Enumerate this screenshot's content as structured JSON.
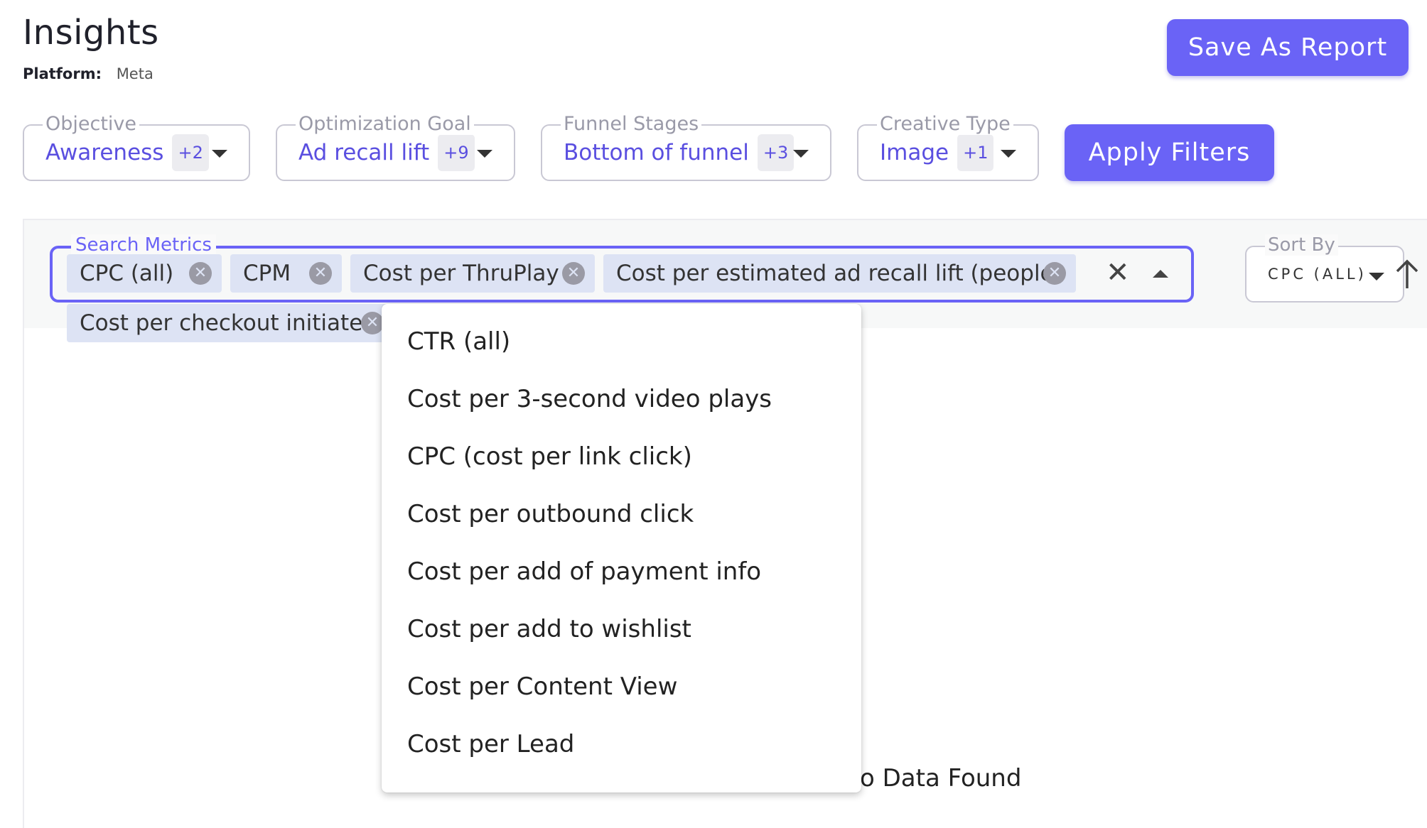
{
  "header": {
    "title": "Insights",
    "platform_label": "Platform:",
    "platform_value": "Meta",
    "save_button": "Save As Report"
  },
  "filters": [
    {
      "label": "Objective",
      "value": "Awareness",
      "badge": "+2"
    },
    {
      "label": "Optimization Goal",
      "value": "Ad recall lift",
      "badge": "+9"
    },
    {
      "label": "Funnel Stages",
      "value": "Bottom of funnel",
      "badge": "+3"
    },
    {
      "label": "Creative Type",
      "value": "Image",
      "badge": "+1"
    }
  ],
  "apply_button": "Apply Filters",
  "search": {
    "label": "Search Metrics",
    "chips": [
      "CPC (all)",
      "CPM",
      "Cost per ThruPlay",
      "Cost per estimated ad recall lift (people)",
      "Cost per checkout initiated"
    ],
    "options": [
      "CTR (all)",
      "Cost per 3-second video plays",
      "CPC (cost per link click)",
      "Cost per outbound click",
      "Cost per add of payment info",
      "Cost per add to wishlist",
      "Cost per Content View",
      "Cost per Lead"
    ]
  },
  "sort": {
    "label": "Sort By",
    "value": "CPC (ALL)"
  },
  "empty_state": "o Data Found",
  "colors": {
    "accent": "#6a63f6",
    "chip_bg": "#dde3f4",
    "filter_value": "#5a4fe0"
  }
}
